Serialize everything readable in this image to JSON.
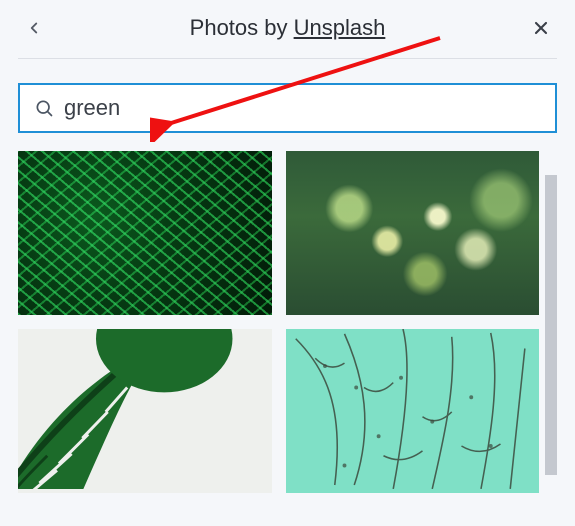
{
  "header": {
    "title_prefix": "Photos by ",
    "provider_name": "Unsplash"
  },
  "search": {
    "value": "green",
    "placeholder": ""
  },
  "results": [
    {
      "alt": "fern leaves dark green"
    },
    {
      "alt": "bokeh grass lights green"
    },
    {
      "alt": "monstera leaf on white"
    },
    {
      "alt": "dry branches on mint wall"
    }
  ],
  "colors": {
    "accent": "#1f8fd6",
    "text": "#2b2f36",
    "muted": "#555b66"
  }
}
